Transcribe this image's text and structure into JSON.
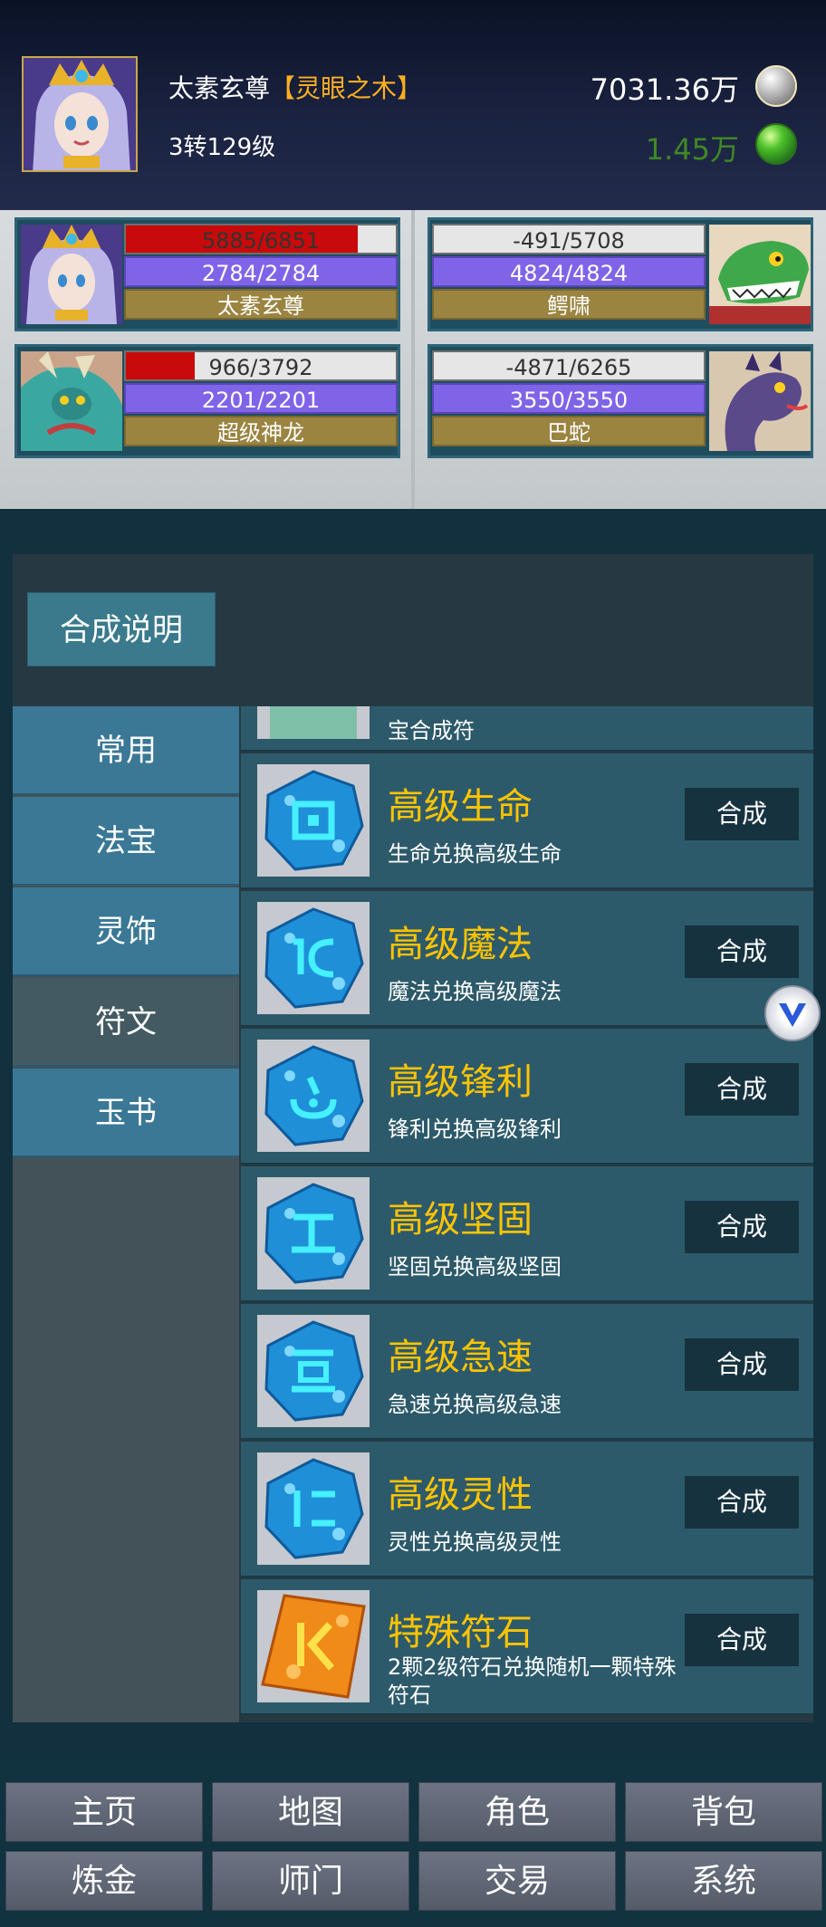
{
  "player": {
    "name": "太素玄尊",
    "title": "【灵眼之木】",
    "level": "3转129级",
    "silver": "7031.36万",
    "jade": "1.45万",
    "silver_icon": "silver-orb-icon",
    "jade_icon": "jade-orb-icon"
  },
  "battle": {
    "allies": [
      {
        "hp": "5885/6851",
        "hp_fraction": 0.859,
        "mp": "2784/2784",
        "name": "太素玄尊",
        "portrait": "goddess-portrait"
      },
      {
        "hp": "966/3792",
        "hp_fraction": 0.255,
        "mp": "2201/2201",
        "name": "超级神龙",
        "portrait": "dragon-portrait"
      }
    ],
    "enemies": [
      {
        "hp": "-491/5708",
        "hp_fraction": 0,
        "mp": "4824/4824",
        "name": "鳄啸",
        "portrait": "crocodile-portrait"
      },
      {
        "hp": "-4871/6265",
        "hp_fraction": 0,
        "mp": "3550/3550",
        "name": "巴蛇",
        "portrait": "serpent-portrait"
      }
    ]
  },
  "synthesis": {
    "help_label": "合成说明",
    "categories": [
      {
        "label": "常用",
        "active": false
      },
      {
        "label": "法宝",
        "active": false
      },
      {
        "label": "灵饰",
        "active": false
      },
      {
        "label": "符文",
        "active": true
      },
      {
        "label": "玉书",
        "active": false
      }
    ],
    "partial_desc": "宝合成符",
    "recipes": [
      {
        "title": "高级生命",
        "desc": "生命兑换高级生命",
        "button": "合成",
        "icon": "blue-rune-icon"
      },
      {
        "title": "高级魔法",
        "desc": "魔法兑换高级魔法",
        "button": "合成",
        "icon": "blue-rune-icon"
      },
      {
        "title": "高级锋利",
        "desc": "锋利兑换高级锋利",
        "button": "合成",
        "icon": "blue-rune-icon"
      },
      {
        "title": "高级坚固",
        "desc": "坚固兑换高级坚固",
        "button": "合成",
        "icon": "blue-rune-icon"
      },
      {
        "title": "高级急速",
        "desc": "急速兑换高级急速",
        "button": "合成",
        "icon": "blue-rune-icon"
      },
      {
        "title": "高级灵性",
        "desc": "灵性兑换高级灵性",
        "button": "合成",
        "icon": "blue-rune-icon"
      },
      {
        "title": "特殊符石",
        "desc": "2颗2级符石兑换随机一颗特殊符石",
        "button": "合成",
        "icon": "orange-rune-icon"
      }
    ]
  },
  "nav": {
    "row1": [
      "主页",
      "地图",
      "角色",
      "背包"
    ],
    "row2": [
      "炼金",
      "师门",
      "交易",
      "系统"
    ]
  },
  "colors": {
    "accent_gold": "#ffc400",
    "title_orange": "#ffb020",
    "hp_red": "#c80a0a",
    "mp_purple": "#8064e8",
    "jade_green": "#3f8a24"
  }
}
